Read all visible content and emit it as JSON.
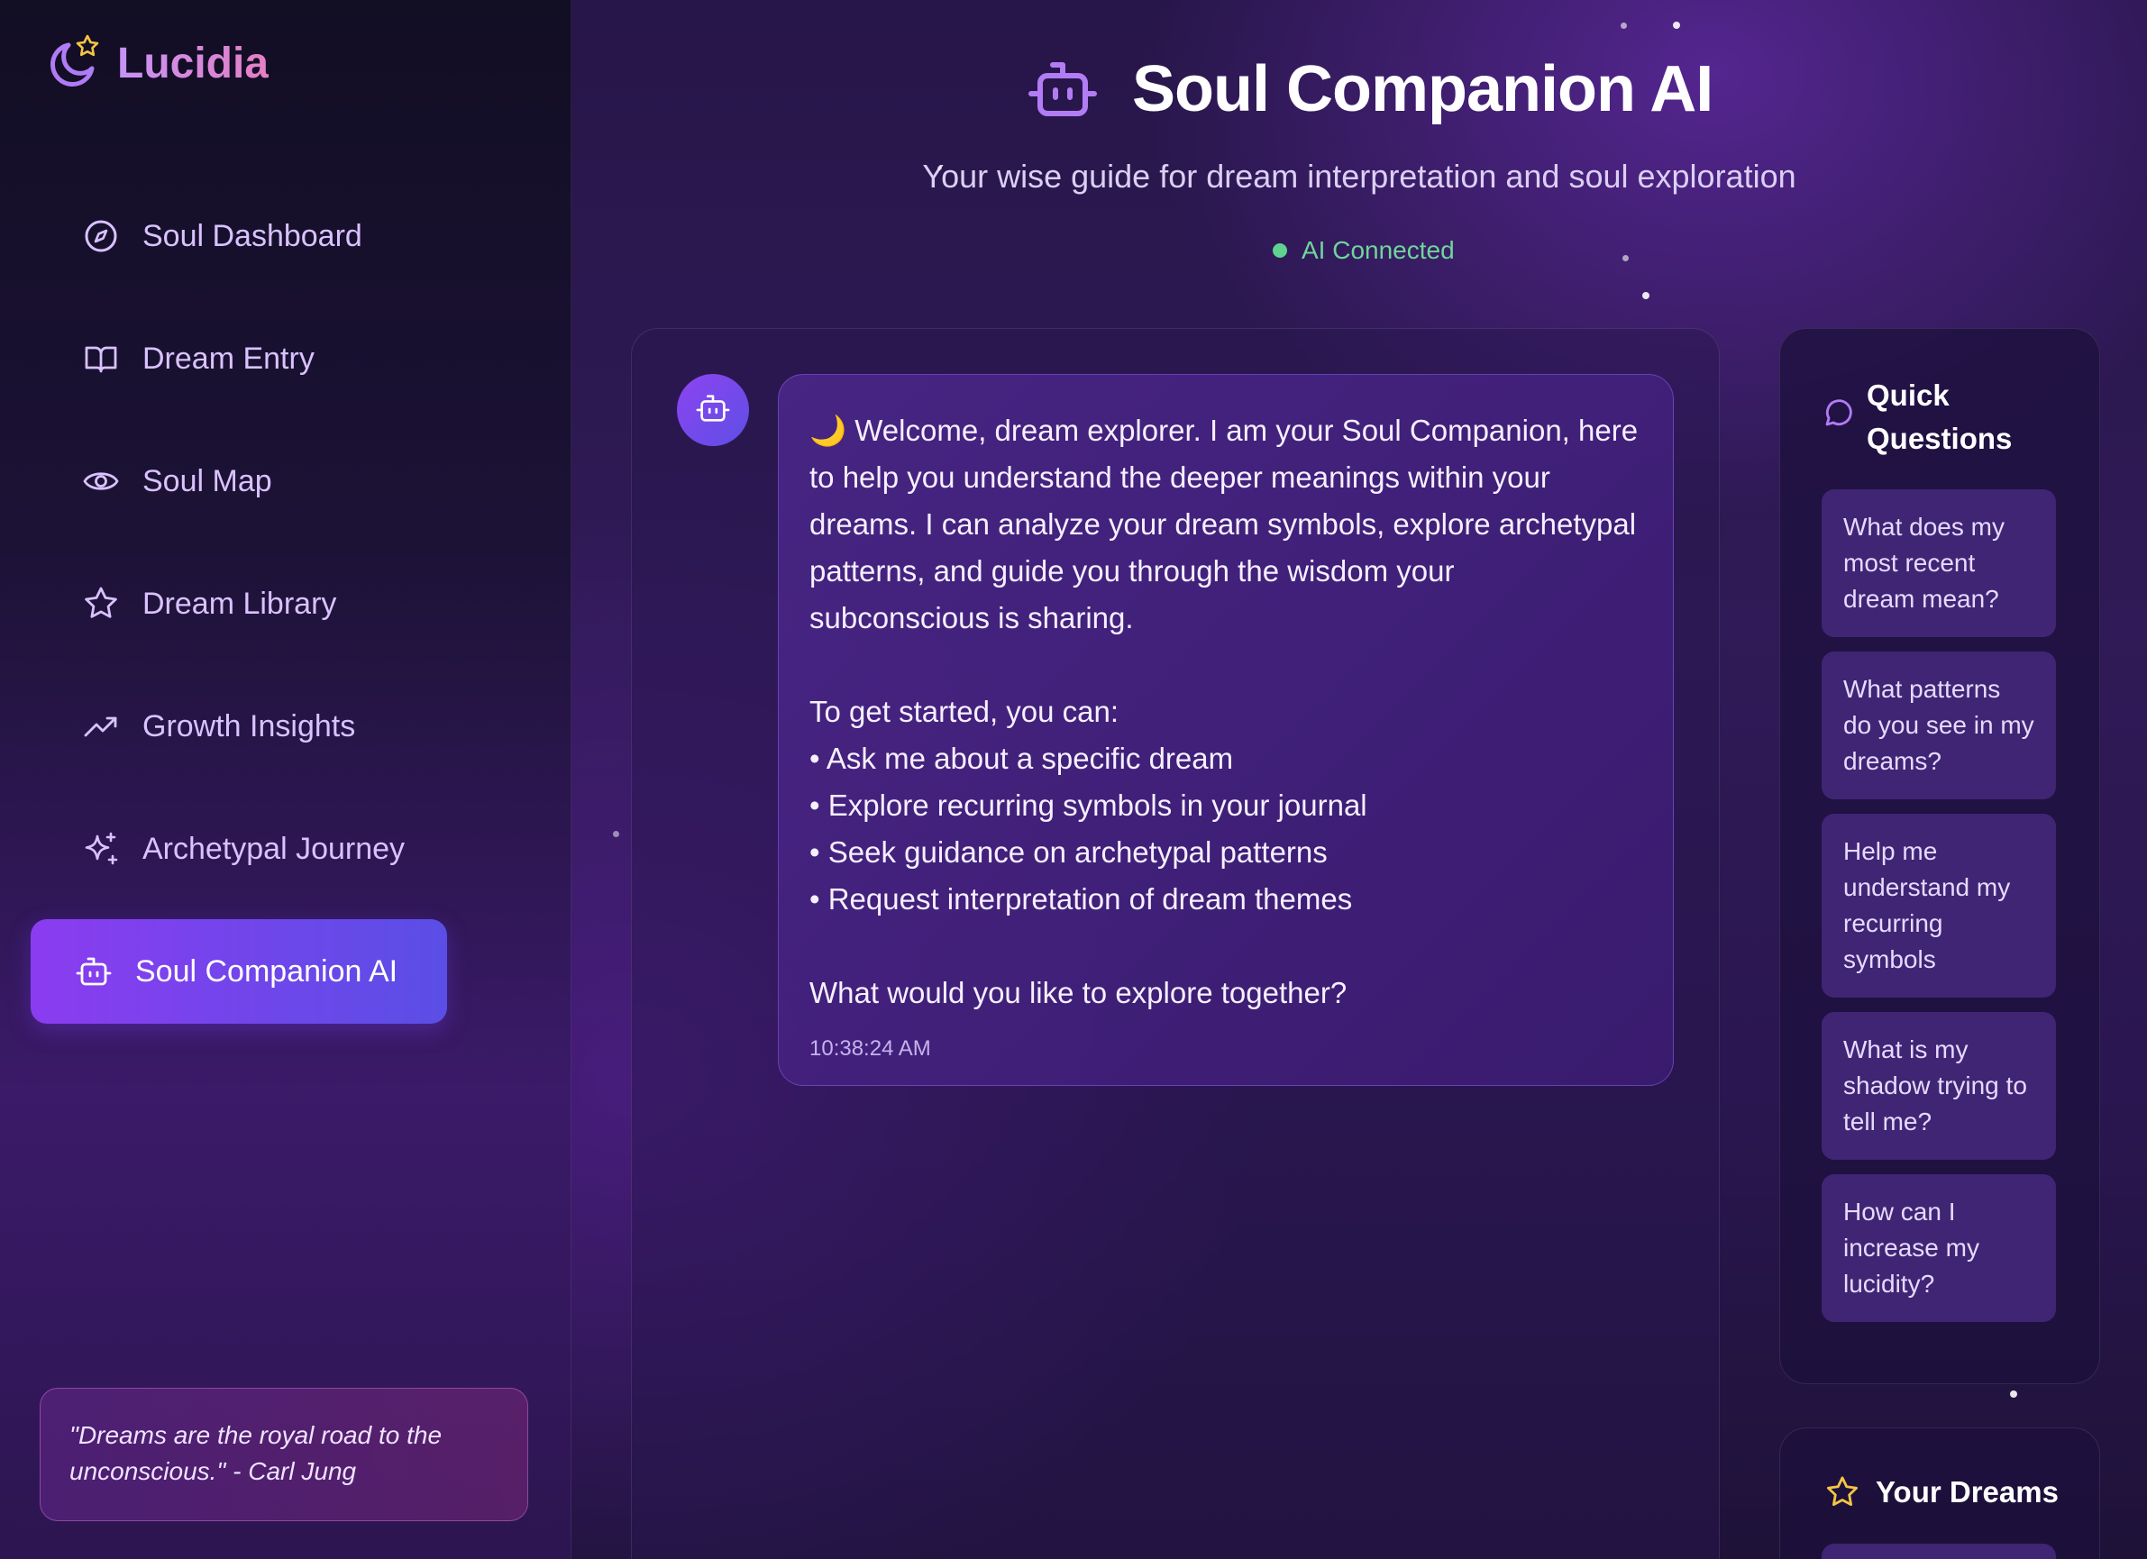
{
  "app": {
    "name": "Lucidia"
  },
  "sidebar": {
    "items": [
      {
        "label": "Soul Dashboard",
        "icon": "compass-icon"
      },
      {
        "label": "Dream Entry",
        "icon": "book-open-icon"
      },
      {
        "label": "Soul Map",
        "icon": "eye-icon"
      },
      {
        "label": "Dream Library",
        "icon": "star-icon"
      },
      {
        "label": "Growth Insights",
        "icon": "trending-up-icon"
      },
      {
        "label": "Archetypal Journey",
        "icon": "sparkles-icon"
      },
      {
        "label": "Soul Companion AI",
        "icon": "bot-icon",
        "active": true
      }
    ],
    "quote": "\"Dreams are the royal road to the unconscious.\" - Carl Jung"
  },
  "header": {
    "title": "Soul Companion AI",
    "subtitle": "Your wise guide for dream interpretation and soul exploration",
    "status": "AI Connected"
  },
  "chat": {
    "message": {
      "intro": "🌙 Welcome, dream explorer. I am your Soul Companion, here to help you understand the deeper meanings within your dreams. I can analyze your dream symbols, explore archetypal patterns, and guide you through the wisdom your subconscious is sharing.",
      "started": "To get started, you can:",
      "bullets": [
        "• Ask me about a specific dream",
        "• Explore recurring symbols in your journal",
        "• Seek guidance on archetypal patterns",
        "• Request interpretation of dream themes"
      ],
      "closing": "What would you like to explore together?",
      "time": "10:38:24 AM"
    }
  },
  "quick_questions": {
    "title": "Quick Questions",
    "items": [
      "What does my most recent dream mean?",
      "What patterns do you see in my dreams?",
      "Help me understand my recurring symbols",
      "What is my shadow trying to tell me?",
      "How can I increase my lucidity?"
    ]
  },
  "your_dreams": {
    "title": "Your Dreams"
  },
  "colors": {
    "accent_start": "#8b3cf0",
    "accent_end": "#5a4ee6",
    "status_green": "#5ed38f",
    "star_gold": "#f5c542"
  }
}
